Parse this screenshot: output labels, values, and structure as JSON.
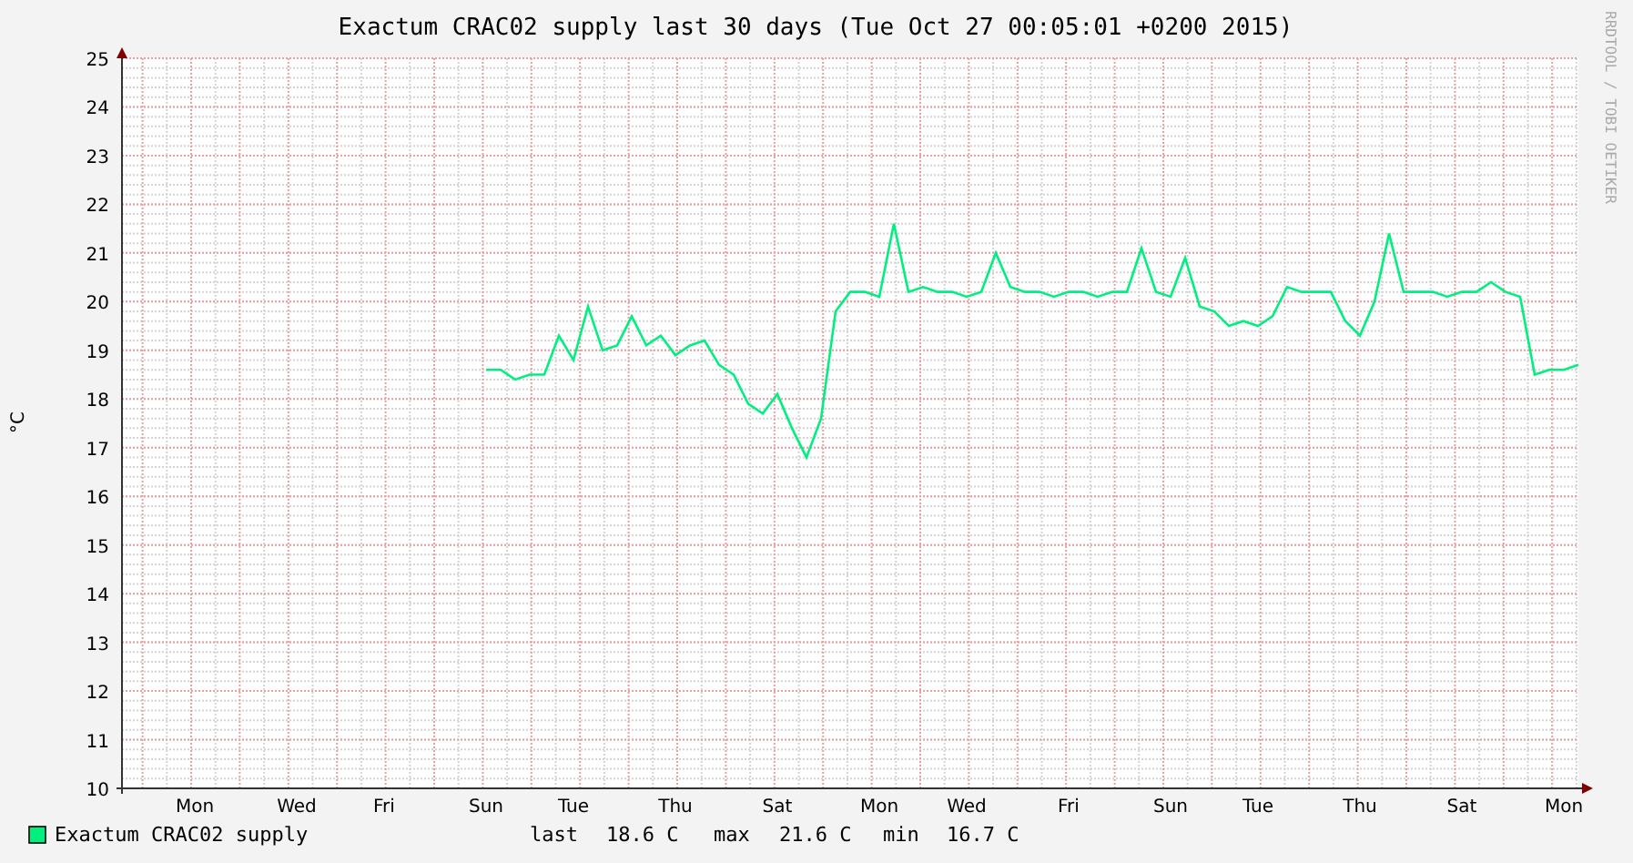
{
  "title": "Exactum CRAC02 supply last 30 days (Tue Oct 27 00:05:01 +0200 2015)",
  "credit": "RRDTOOL / TOBI OETIKER",
  "chart_data": {
    "type": "line",
    "ylabel": "°C",
    "grid": true,
    "ylim": [
      10,
      25
    ],
    "yticks": [
      10,
      11,
      12,
      13,
      14,
      15,
      16,
      17,
      18,
      19,
      20,
      21,
      22,
      23,
      24,
      25
    ],
    "categories": [
      null,
      null,
      null,
      null,
      null,
      "Mon",
      null,
      null,
      null,
      null,
      null,
      null,
      "Wed",
      null,
      null,
      null,
      null,
      null,
      "Fri",
      null,
      null,
      null,
      null,
      null,
      null,
      "Sun",
      null,
      null,
      null,
      null,
      null,
      "Tue",
      null,
      null,
      null,
      null,
      null,
      null,
      "Thu",
      null,
      null,
      null,
      null,
      null,
      null,
      "Sat",
      null,
      null,
      null,
      null,
      null,
      null,
      "Mon",
      null,
      null,
      null,
      null,
      null,
      "Wed",
      null,
      null,
      null,
      null,
      null,
      null,
      "Fri",
      null,
      null,
      null,
      null,
      null,
      null,
      "Sun",
      null,
      null,
      null,
      null,
      null,
      "Tue",
      null,
      null,
      null,
      null,
      null,
      null,
      "Thu",
      null,
      null,
      null,
      null,
      null,
      null,
      "Sat",
      null,
      null,
      null,
      null,
      null,
      null,
      "Mon",
      null
    ],
    "series": [
      {
        "name": "Exactum CRAC02 supply",
        "color": "#00f080",
        "values": [
          null,
          null,
          null,
          null,
          null,
          null,
          null,
          null,
          null,
          null,
          null,
          null,
          null,
          null,
          null,
          null,
          null,
          null,
          null,
          null,
          null,
          null,
          null,
          null,
          null,
          18.6,
          18.6,
          18.4,
          18.5,
          18.5,
          19.3,
          18.8,
          19.9,
          19.0,
          19.1,
          19.7,
          19.1,
          19.3,
          18.9,
          19.1,
          19.2,
          18.7,
          18.5,
          17.9,
          17.7,
          18.1,
          17.4,
          16.8,
          17.6,
          19.8,
          20.2,
          20.2,
          20.1,
          21.6,
          20.2,
          20.3,
          20.2,
          20.2,
          20.1,
          20.2,
          21.0,
          20.3,
          20.2,
          20.2,
          20.1,
          20.2,
          20.2,
          20.1,
          20.2,
          20.2,
          21.1,
          20.2,
          20.1,
          20.9,
          19.9,
          19.8,
          19.5,
          19.6,
          19.5,
          19.7,
          20.3,
          20.2,
          20.2,
          20.2,
          19.6,
          19.3,
          20.0,
          21.4,
          20.2,
          20.2,
          20.2,
          20.1,
          20.2,
          20.2,
          20.4,
          20.2,
          20.1,
          18.5,
          18.6,
          18.6,
          18.7
        ]
      }
    ]
  },
  "legend": {
    "stats": [
      {
        "label": "last",
        "value": "18.6 C"
      },
      {
        "label": "max",
        "value": "21.6 C"
      },
      {
        "label": "min",
        "value": "16.7 C"
      }
    ]
  }
}
